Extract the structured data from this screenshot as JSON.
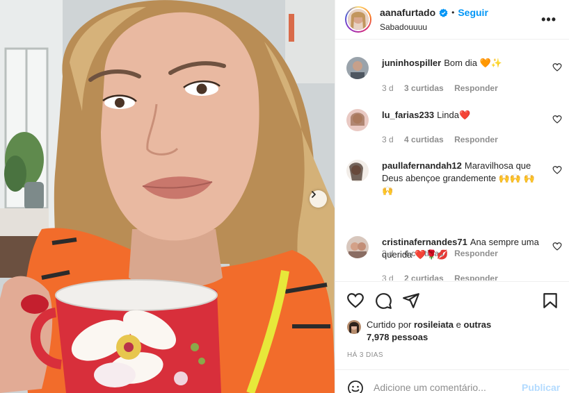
{
  "post": {
    "username": "aanafurtado",
    "follow_label": "Seguir",
    "separator": "•",
    "location": "Sabadouuuu",
    "more_label": "•••"
  },
  "comments": [
    {
      "username": "juninhospiller",
      "text": "Bom dia 🧡✨",
      "age": "3 d",
      "likes": "3 curtidas",
      "reply": "Responder"
    },
    {
      "username": "lu_farias233",
      "text": "Linda❤️",
      "age": "3 d",
      "likes": "4 curtidas",
      "reply": "Responder"
    },
    {
      "username": "paullafernandah12",
      "text": "Maravilhosa que Deus abençoe grandemente 🙌🙌 🙌🙌",
      "age": "3 d",
      "likes": "4 curtidas",
      "reply": "Responder"
    },
    {
      "username": "cristinafernandes71",
      "text": "Ana sempre uma querida ❤️🌹💋",
      "age": "3 d",
      "likes": "2 curtidas",
      "reply": "Responder"
    }
  ],
  "likes": {
    "prefix": "Curtido por",
    "user": "rosileiata",
    "connector": "e",
    "others": "outras 7,978 pessoas"
  },
  "date_label": "HÁ 3 DIAS",
  "add_comment": {
    "placeholder": "Adicione um comentário...",
    "publish_label": "Publicar"
  },
  "colors": {
    "accent": "#0095f6",
    "publish_disabled": "#b3dbff",
    "muted": "#8e8e8e"
  },
  "icons": {
    "verified": "verified-badge-icon",
    "like": "heart-icon",
    "comment": "comment-bubble-icon",
    "share": "paper-plane-icon",
    "save": "bookmark-icon",
    "emoji": "smiley-icon",
    "next": "chevron-right-icon"
  }
}
